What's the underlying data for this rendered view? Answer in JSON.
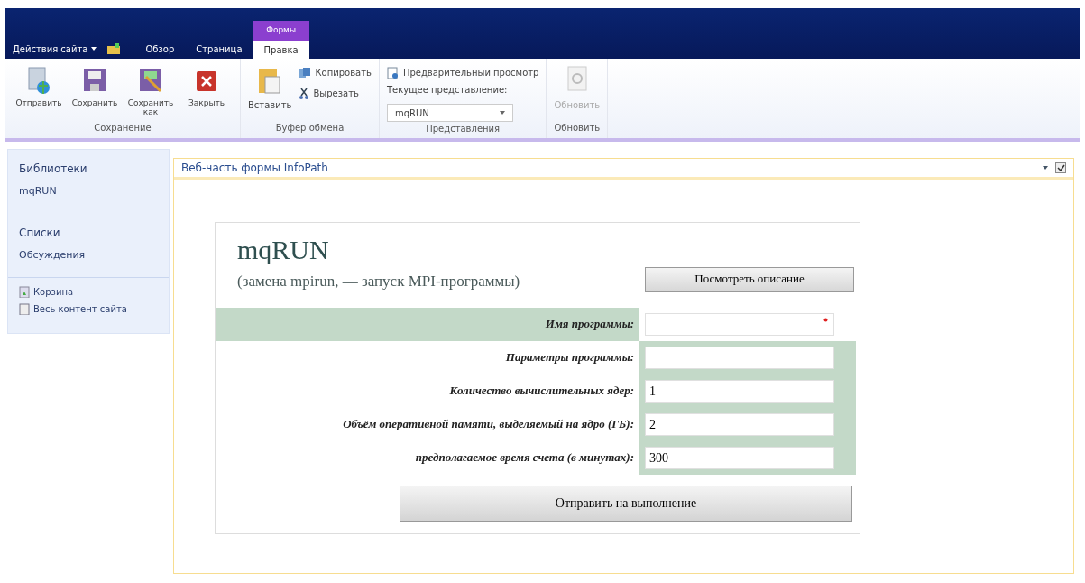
{
  "top_bar": {
    "site_actions": "Действия сайта",
    "tabs": [
      {
        "label": "Обзор",
        "selected": false
      },
      {
        "label": "Страница",
        "selected": false
      },
      {
        "label": "Правка",
        "selected": true,
        "context": "Формы"
      }
    ]
  },
  "ribbon": {
    "groups": [
      {
        "kind": "large",
        "title": "Сохранение",
        "buttons": [
          {
            "label": "Отправить"
          },
          {
            "label": "Сохранить"
          },
          {
            "label": "Сохранить как"
          },
          {
            "label": "Закрыть"
          }
        ]
      },
      {
        "kind": "clipboard",
        "title": "Буфер обмена",
        "paste": "Вставить",
        "copy": "Копировать",
        "cut": "Вырезать"
      },
      {
        "kind": "views",
        "title": "Представления",
        "preview": "Предварительный просмотр",
        "current_label": "Текущее представление:",
        "current_value": "mqRUN"
      },
      {
        "kind": "refresh",
        "title": "Обновить",
        "button": "Обновить",
        "disabled": true
      }
    ]
  },
  "sidebar": {
    "sections": [
      {
        "items": [
          "Библиотеки",
          "mqRUN"
        ]
      },
      {
        "items": [
          "Списки",
          "Обсуждения"
        ]
      }
    ],
    "footer": [
      {
        "label": "Корзина"
      },
      {
        "label": "Весь контент сайта"
      }
    ]
  },
  "web_part": {
    "title": "Веб-часть формы InfoPath",
    "checked": true,
    "form": {
      "title": "mqRUN",
      "subtitle": "(замена mpirun, — запуск MPI-программы)",
      "describe_button": "Посмотреть описание",
      "fields": [
        {
          "label": "Имя программы:",
          "required": true,
          "highlighted": true
        },
        {
          "label": "Параметры программы:",
          "required": false,
          "highlighted": false
        },
        {
          "label": "Количество вычислительных ядер:",
          "value": "1",
          "required": false,
          "highlighted": false
        },
        {
          "label": "Объём оперативной памяти, выделяемый на ядро (ГБ):",
          "value": "2",
          "required": false,
          "highlighted": false
        },
        {
          "label": "предполагаемое время  счета (в минутах):",
          "value": "300",
          "required": false,
          "highlighted": false
        }
      ],
      "submit_button": "Отправить на выполнение"
    }
  }
}
